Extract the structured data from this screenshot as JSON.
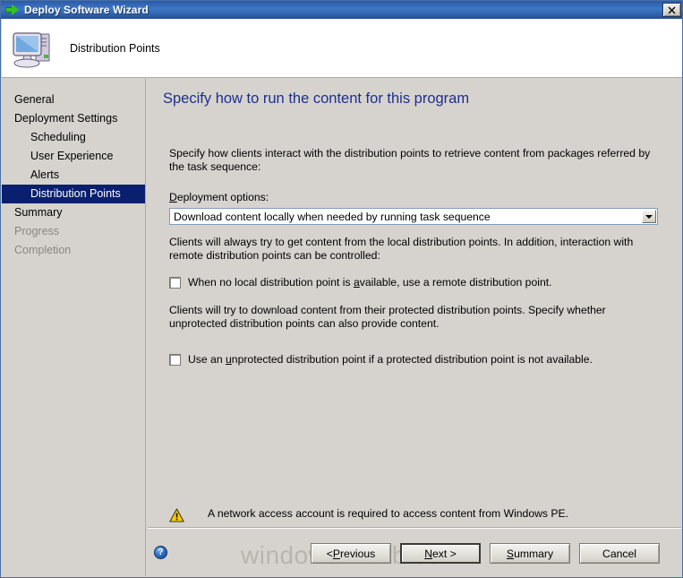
{
  "window": {
    "title": "Deploy Software Wizard",
    "title_icon": "green-arrow-icon",
    "close_label": "×"
  },
  "header": {
    "title": "Distribution Points",
    "icon": "computer-icon"
  },
  "sidebar": {
    "items": [
      {
        "label": "General",
        "level": 0,
        "state": "normal"
      },
      {
        "label": "Deployment Settings",
        "level": 0,
        "state": "normal"
      },
      {
        "label": "Scheduling",
        "level": 1,
        "state": "normal"
      },
      {
        "label": "User Experience",
        "level": 1,
        "state": "normal"
      },
      {
        "label": "Alerts",
        "level": 1,
        "state": "normal"
      },
      {
        "label": "Distribution Points",
        "level": 1,
        "state": "selected"
      },
      {
        "label": "Summary",
        "level": 0,
        "state": "normal"
      },
      {
        "label": "Progress",
        "level": 0,
        "state": "disabled"
      },
      {
        "label": "Completion",
        "level": 0,
        "state": "disabled"
      }
    ]
  },
  "main": {
    "heading": "Specify how to run the content for this program",
    "intro_paragraph": "Specify how clients interact with the distribution points to retrieve content from packages referred by the task sequence:",
    "deployment_options_label_pre": "D",
    "deployment_options_label_post": "eployment options:",
    "deployment_options_value": "Download content locally when needed by running task sequence",
    "paragraph_local_dp": "Clients will always try to get content from the local distribution points. In addition, interaction with remote distribution points can be controlled:",
    "checkbox_remote_pre": "When no local distribution point is ",
    "checkbox_remote_key": "a",
    "checkbox_remote_post": "vailable, use a remote distribution point.",
    "checkbox_remote_checked": false,
    "paragraph_protected_dp": "Clients will try to download content from their protected distribution points. Specify whether unprotected distribution points can also provide content.",
    "checkbox_unprotected_pre": "Use an ",
    "checkbox_unprotected_key": "u",
    "checkbox_unprotected_post": "nprotected distribution point if a protected distribution point is not available.",
    "checkbox_unprotected_checked": false,
    "warning_text": "A network access account is required to access content from Windows PE.",
    "warning_icon": "warning-triangle-icon"
  },
  "footer": {
    "help_icon_label": "?",
    "watermark": "windows-noob.com",
    "buttons": [
      {
        "name": "previous",
        "pre": "< ",
        "key": "P",
        "post": "revious",
        "default": false
      },
      {
        "name": "next",
        "pre": "",
        "key": "N",
        "post": "ext >",
        "default": true
      },
      {
        "name": "summary",
        "pre": "",
        "key": "S",
        "post": "ummary",
        "default": false
      },
      {
        "name": "cancel",
        "pre": "",
        "key": "",
        "post": "Cancel",
        "default": false
      }
    ]
  },
  "colors": {
    "titlebar_blue": "#2f62b0",
    "dialog_face": "#d6d3ce",
    "heading_blue": "#1d2f8e",
    "selection_navy": "#0a1f6e",
    "warning_yellow": "#ffcc00"
  }
}
